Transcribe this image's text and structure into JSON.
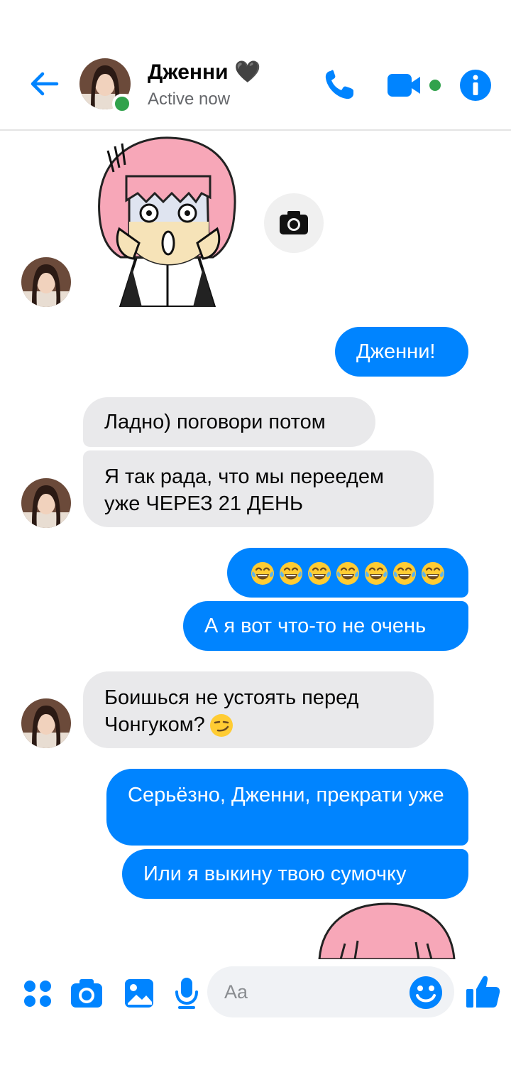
{
  "header": {
    "contact_name": "Дженни 🖤",
    "status": "Active now"
  },
  "messages": [
    {
      "id": "m1",
      "dir": "out",
      "text": "Дженни!"
    },
    {
      "id": "m2",
      "dir": "in",
      "text": "Ладно) поговори потом"
    },
    {
      "id": "m3",
      "dir": "in",
      "text": "Я так рада, что мы переедем уже ЧЕРЕЗ 21 ДЕНЬ"
    },
    {
      "id": "m4",
      "dir": "out",
      "emoji": "tears-of-joy",
      "emoji_count": 7
    },
    {
      "id": "m5",
      "dir": "out",
      "text": "А я вот что-то не очень"
    },
    {
      "id": "m6",
      "dir": "in",
      "text": "Боишься не устоять перед Чонгуком?",
      "trailing_emoji": "smirk"
    },
    {
      "id": "m7",
      "dir": "out",
      "text": "Серьёзно, Дженни, прекрати уже"
    },
    {
      "id": "m8",
      "dir": "out",
      "text": "Или я выкину твою сумочку"
    }
  ],
  "composer": {
    "placeholder": "Aa"
  },
  "colors": {
    "accent": "#0084ff",
    "incoming_bubble": "#e9e9eb",
    "online": "#31a24c"
  },
  "icons": [
    "back-arrow-icon",
    "phone-icon",
    "video-camera-icon",
    "info-icon",
    "camera-icon",
    "apps-icon",
    "gallery-icon",
    "microphone-icon",
    "smiley-icon",
    "thumbs-up-icon"
  ]
}
